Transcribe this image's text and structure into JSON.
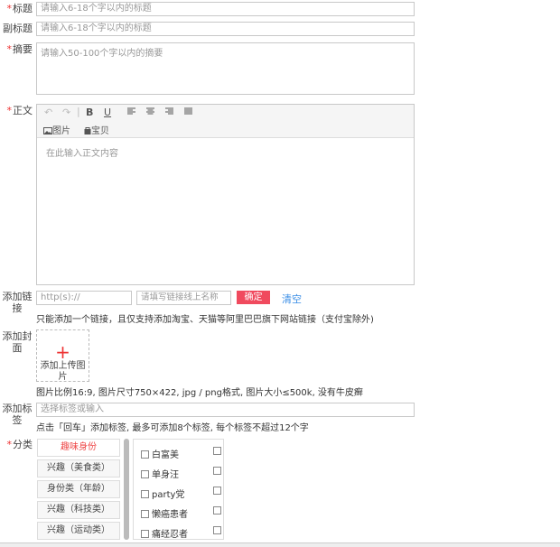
{
  "form": {
    "title": {
      "label": "标题",
      "required": true,
      "placeholder": "请输入6-18个字以内的标题"
    },
    "subtitle": {
      "label": "副标题",
      "required": false,
      "placeholder": "请输入6-18个字以内的标题"
    },
    "summary": {
      "label": "摘要",
      "required": true,
      "placeholder": "请输入50-100个字以内的摘要"
    },
    "body": {
      "label": "正文",
      "required": true,
      "placeholder": "在此输入正文内容",
      "toolbar": {
        "undo": "↶",
        "redo": "↷",
        "bold": "B",
        "underline": "U",
        "image_label": "图片",
        "item_label": "宝贝"
      }
    },
    "link": {
      "label": "添加链接",
      "url_placeholder": "http(s)://",
      "name_placeholder": "请填写链接线上名称",
      "confirm_label": "确定",
      "clear_label": "清空",
      "hint": "只能添加一个链接，且仅支持添加淘宝、天猫等阿里巴巴旗下网站链接（支付宝除外)"
    },
    "cover": {
      "label": "添加封面",
      "upload_plus": "+",
      "upload_label": "添加上传图片",
      "hint": "图片比例16:9, 图片尺寸750×422, jpg / png格式, 图片大小≤500k, 没有牛皮癣"
    },
    "tags": {
      "label": "添加标签",
      "placeholder": "选择标签或输入",
      "hint": "点击「回车」添加标签, 最多可添加8个标签, 每个标签不超过12个字"
    },
    "category": {
      "label": "分类",
      "required": true,
      "items": [
        "趣味身份",
        "兴趣（美食类）",
        "身份类（年龄）",
        "兴趣（科技类）",
        "兴趣（运动类）"
      ],
      "active_index": 0,
      "options": [
        "白富美",
        "单身汪",
        "party党",
        "懒癌患者",
        "痛经忍者"
      ]
    }
  }
}
